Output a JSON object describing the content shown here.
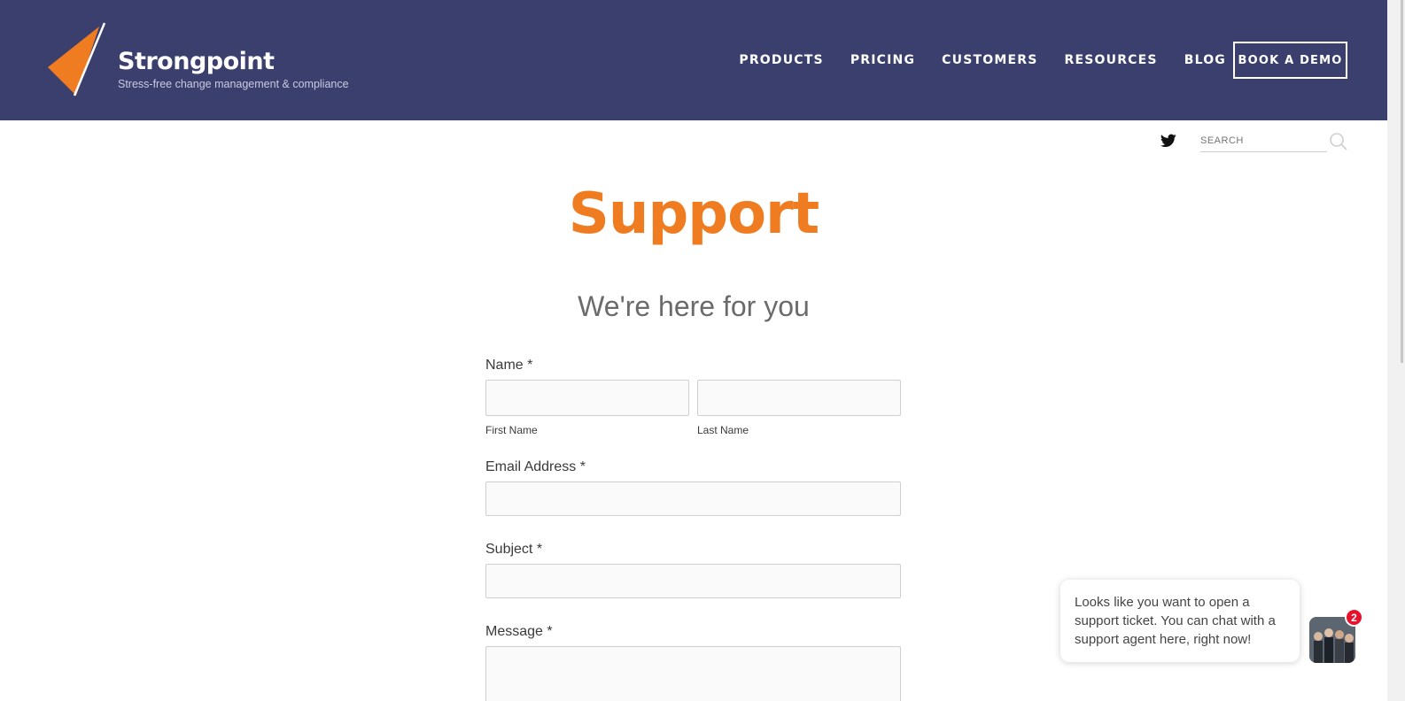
{
  "brand": {
    "name": "Strongpoint",
    "tagline": "Stress-free change management & compliance",
    "logo_color": "#f07c22"
  },
  "nav": {
    "items": [
      "PRODUCTS",
      "PRICING",
      "CUSTOMERS",
      "RESOURCES",
      "BLOG"
    ],
    "cta": "BOOK A DEMO"
  },
  "utility": {
    "social_icon": "twitter-icon",
    "search_placeholder": "SEARCH",
    "search_icon": "search-icon"
  },
  "page": {
    "title": "Support",
    "subtitle": "We're here for you"
  },
  "form": {
    "name_label": "Name *",
    "first_name_label": "First Name",
    "last_name_label": "Last Name",
    "email_label": "Email Address *",
    "subject_label": "Subject *",
    "message_label": "Message *"
  },
  "chat": {
    "message": "Looks like you want to open a support ticket. You can chat with a support agent here, right now!",
    "badge_count": "2"
  },
  "colors": {
    "header_bg": "#3b3f6e",
    "accent": "#f07c22",
    "badge": "#e8102a"
  }
}
